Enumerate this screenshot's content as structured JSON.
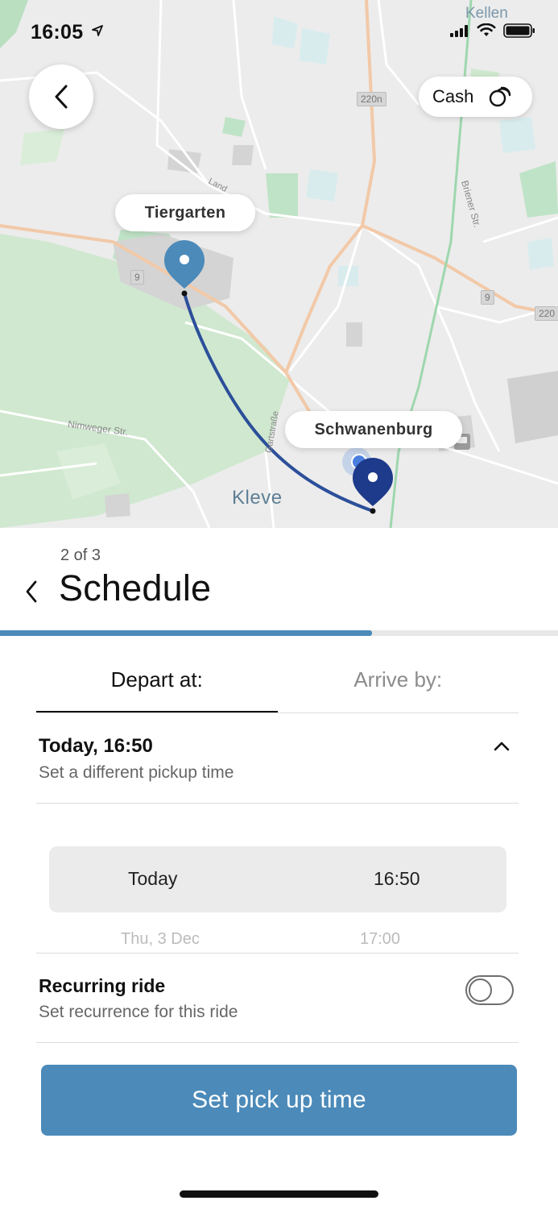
{
  "status_bar": {
    "time": "16:05",
    "icons": [
      "location-arrow-icon",
      "signal-icon",
      "wifi-icon",
      "battery-icon"
    ]
  },
  "map": {
    "payment_label": "Cash",
    "pickup_label": "Tiergarten",
    "dropoff_label": "Schwanenburg",
    "city_label": "Kleve",
    "town_label": "Kellen",
    "street_labels": [
      "Nimweger Str.",
      "Gartstraße",
      "Briener Str.",
      "Land"
    ],
    "road_badges": [
      "220n",
      "9",
      "9",
      "220"
    ],
    "route_color": "#2c4f9a",
    "pickup_pin_color": "#4b8ab9",
    "dropoff_pin_color": "#1e3a8a"
  },
  "sheet": {
    "step": "2 of 3",
    "title": "Schedule",
    "progress_fraction": 0.667,
    "tabs": [
      {
        "label": "Depart at:",
        "active": true
      },
      {
        "label": "Arrive by:",
        "active": false
      }
    ],
    "time_summary": {
      "main": "Today, 16:50",
      "sub": "Set a different pickup time"
    },
    "picker": {
      "selected_day": "Today",
      "selected_time": "16:50",
      "next_day": "Thu, 3 Dec",
      "next_time": "17:00"
    },
    "recurring": {
      "title": "Recurring ride",
      "sub": "Set recurrence for this ride",
      "enabled": false
    },
    "cta_label": "Set pick up time"
  },
  "colors": {
    "accent": "#4b8ab9",
    "text_primary": "#111111",
    "text_secondary": "#666666"
  }
}
